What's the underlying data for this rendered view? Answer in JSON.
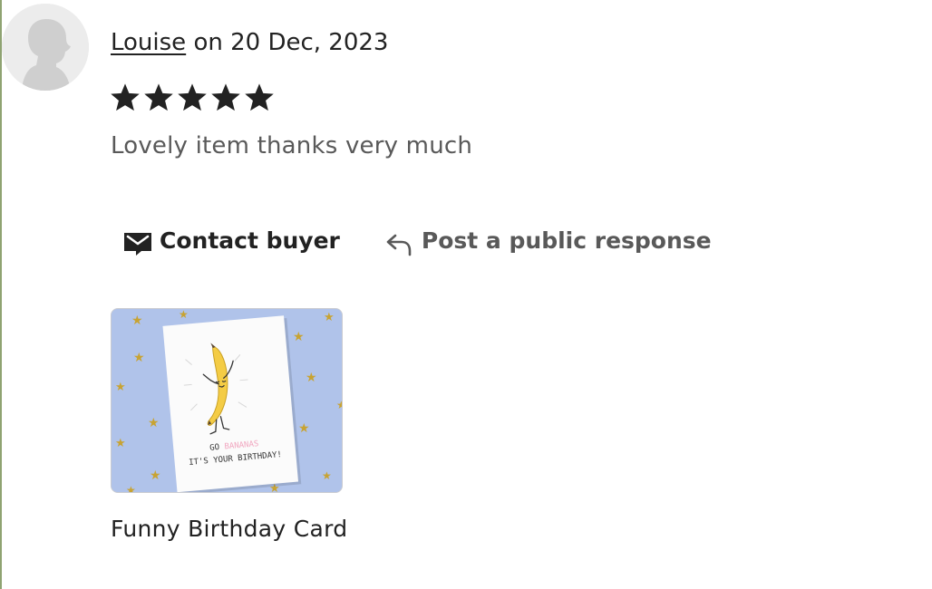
{
  "review": {
    "reviewer_name": "Louise",
    "date_text": "on 20 Dec, 2023",
    "rating": 5,
    "rating_max": 5,
    "text": "Lovely item thanks very much"
  },
  "actions": {
    "contact_label": "Contact buyer",
    "respond_label": "Post a public response"
  },
  "item": {
    "card_line1_prefix": "GO ",
    "card_line1_highlight": "BANANAS",
    "card_line2": "IT'S YOUR BIRTHDAY!",
    "caption": "Funny Birthday Card"
  },
  "colors": {
    "text": "#222222",
    "muted_text": "#595959",
    "left_rule": "#8fa372",
    "thumbnail_background": "#b0c3ea",
    "banana": "#f4cc45",
    "star_gold": "#c8a332"
  },
  "icons": {
    "avatar": "default-avatar-icon",
    "rating_star": "star-icon",
    "contact": "envelope-icon",
    "respond": "reply-arrow-icon"
  }
}
